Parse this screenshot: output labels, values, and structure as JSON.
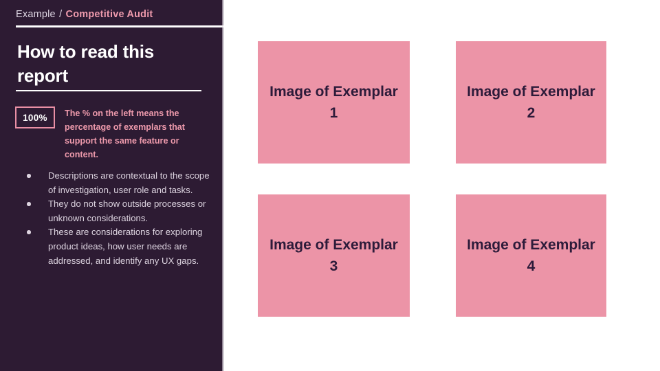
{
  "slide": {
    "background_color": "#ffffff"
  },
  "sidebar": {
    "background_color": "#2d1b33",
    "breadcrumb": {
      "root": "Example",
      "separator": "/",
      "current": "Competitive Audit"
    },
    "heading": "How to read this report",
    "legend": {
      "badge_value": "100%",
      "badge_border_color": "#e98fa5",
      "note": "The % on the left means the percentage of exemplars that support the same feature or content.",
      "note_color": "#ee9aac"
    },
    "notes": [
      "Descriptions are contextual to the scope of investigation, user role and tasks.",
      "They do not show outside processes or unknown considerations.",
      "These are considerations for exploring product ideas, how user needs are addressed, and identify any UX gaps."
    ]
  },
  "main": {
    "exemplars": [
      {
        "label": "Image of Exemplar 1"
      },
      {
        "label": "Image of Exemplar 2"
      },
      {
        "label": "Image of Exemplar 3"
      },
      {
        "label": "Image of Exemplar 4"
      }
    ],
    "placeholder_color": "#ec94a7",
    "placeholder_text_color": "#2d1b3a"
  }
}
